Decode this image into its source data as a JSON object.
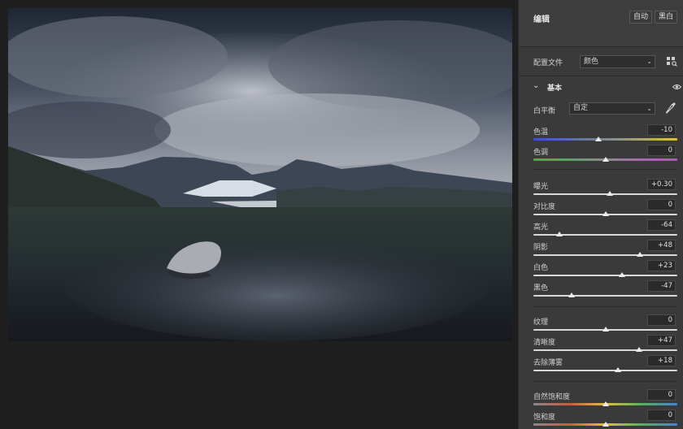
{
  "panel": {
    "title": "编辑",
    "auto_button": "自动",
    "bw_button": "黑白",
    "profile_label": "配置文件",
    "profile_value": "颜色",
    "section_title": "基本",
    "wb_label": "白平衡",
    "wb_value": "自定"
  },
  "sliders": [
    {
      "id": "temp",
      "label": "色温",
      "value": "-10",
      "level": -0.1
    },
    {
      "id": "tint",
      "label": "色调",
      "value": "0",
      "level": 0
    },
    {
      "id": "exposure",
      "label": "曝光",
      "value": "+0.30",
      "level": 0.06
    },
    {
      "id": "contrast",
      "label": "对比度",
      "value": "0",
      "level": 0
    },
    {
      "id": "highlights",
      "label": "高光",
      "value": "-64",
      "level": -0.64
    },
    {
      "id": "shadows",
      "label": "阴影",
      "value": "+48",
      "level": 0.48
    },
    {
      "id": "whites",
      "label": "白色",
      "value": "+23",
      "level": 0.23
    },
    {
      "id": "blacks",
      "label": "黑色",
      "value": "-47",
      "level": -0.47
    },
    {
      "id": "texture",
      "label": "纹理",
      "value": "0",
      "level": 0
    },
    {
      "id": "clarity",
      "label": "清晰度",
      "value": "+47",
      "level": 0.47
    },
    {
      "id": "dehaze",
      "label": "去除薄雾",
      "value": "+18",
      "level": 0.18
    },
    {
      "id": "vibrance",
      "label": "自然饱和度",
      "value": "0",
      "level": 0
    },
    {
      "id": "saturation",
      "label": "饱和度",
      "value": "0",
      "level": 0
    }
  ],
  "icons": {
    "grid": "profile-browser-icon",
    "dropper": "eyedropper-icon",
    "eye": "eye-icon",
    "chevron": "chevron-down-icon"
  },
  "colors": {
    "panel_bg": "#3a3a3a",
    "canvas_bg": "#1f1f1f",
    "value_box": "#2a2a2a"
  }
}
